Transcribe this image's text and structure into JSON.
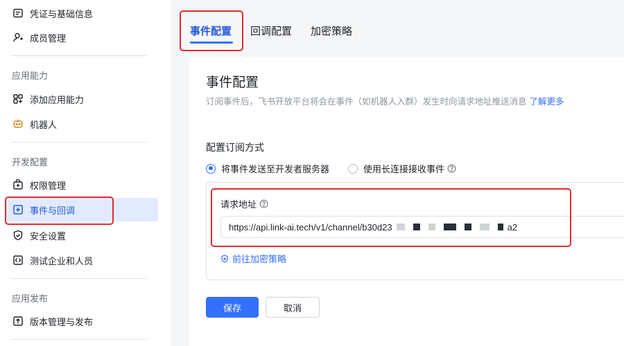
{
  "sidebar": {
    "items": [
      {
        "label": "凭证与基础信息",
        "icon": "credential-icon"
      },
      {
        "label": "成员管理",
        "icon": "member-add-icon"
      },
      {
        "label": "添加应用能力",
        "icon": "grid-add-icon"
      },
      {
        "label": "机器人",
        "icon": "robot-icon"
      },
      {
        "label": "权限管理",
        "icon": "lock-box-icon"
      },
      {
        "label": "事件与回调",
        "icon": "plus-box-icon"
      },
      {
        "label": "安全设置",
        "icon": "shield-icon"
      },
      {
        "label": "测试企业和人员",
        "icon": "code-box-icon"
      },
      {
        "label": "版本管理与发布",
        "icon": "upload-box-icon"
      }
    ],
    "groups": [
      "应用能力",
      "开发配置",
      "应用发布"
    ],
    "active_item": "事件与回调"
  },
  "tabs": {
    "items": [
      "事件配置",
      "回调配置",
      "加密策略"
    ],
    "active": "事件配置"
  },
  "event_config": {
    "title": "事件配置",
    "description": "订阅事件后，飞书开放平台将会在事件（如机器人入群）发生时向请求地址推送消息",
    "learn_more": "了解更多",
    "subscription_method_title": "配置订阅方式",
    "options": [
      {
        "label": "将事件发送至开发者服务器",
        "selected": true
      },
      {
        "label": "使用长连接接收事件",
        "selected": false
      }
    ],
    "request_url_label": "请求地址",
    "request_url_prefix": "https://api.link-ai.tech/v1/channel/b30d23",
    "request_url_suffix": "a2",
    "encrypt_link": "前往加密策略"
  },
  "buttons": {
    "save": "保存",
    "cancel": "取消"
  },
  "colors": {
    "accent": "#3370ff",
    "active_bg": "#e1eaff",
    "highlight": "#e02d2d"
  }
}
